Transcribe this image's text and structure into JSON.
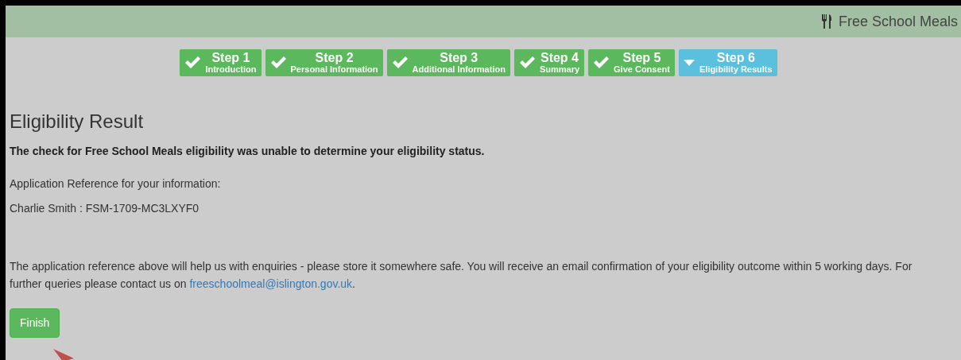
{
  "header": {
    "title": "Free School Meals"
  },
  "steps": [
    {
      "title": "Step 1",
      "subtitle": "Introduction",
      "selected": false
    },
    {
      "title": "Step 2",
      "subtitle": "Personal Information",
      "selected": false
    },
    {
      "title": "Step 3",
      "subtitle": "Additional Information",
      "selected": false
    },
    {
      "title": "Step 4",
      "subtitle": "Summary",
      "selected": false
    },
    {
      "title": "Step 5",
      "subtitle": "Give Consent",
      "selected": false
    },
    {
      "title": "Step 6",
      "subtitle": "Eligibility Results",
      "selected": true
    }
  ],
  "heading": "Eligibility Result",
  "result_message": "The check for Free School Meals eligibility was unable to determine your eligibility status.",
  "reference_label": "Application Reference for your information:",
  "reference_value": "Charlie Smith : FSM-1709-MC3LXYF0",
  "notice_text": "The application reference above will help us with enquiries - please store it somewhere safe. You will receive an email confirmation of your eligibility outcome within 5 working days. For further queries please contact us on",
  "notice_link": "freeschoolmeal@islington.gov.uk",
  "notice_end": ".",
  "finish_button": "Finish"
}
